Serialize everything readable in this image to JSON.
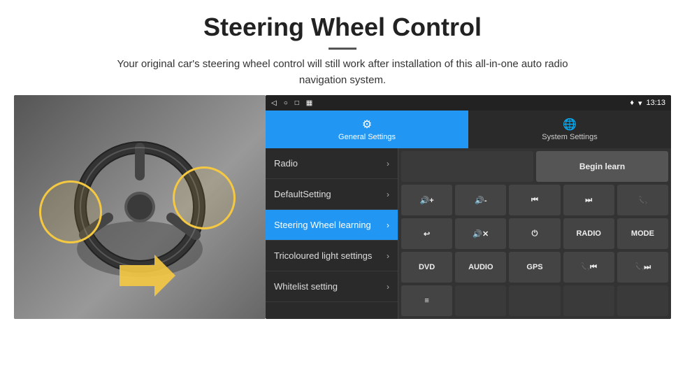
{
  "header": {
    "title": "Steering Wheel Control",
    "subtitle": "Your original car's steering wheel control will still work after installation of this all-in-one auto radio navigation system."
  },
  "status_bar": {
    "back_icon": "◁",
    "home_icon": "○",
    "recent_icon": "□",
    "screen_icon": "▦",
    "location_icon": "♦",
    "wifi_icon": "▾",
    "time": "13:13"
  },
  "tabs": [
    {
      "id": "general",
      "label": "General Settings",
      "icon": "⚙",
      "active": true
    },
    {
      "id": "system",
      "label": "System Settings",
      "icon": "🌐",
      "active": false
    }
  ],
  "menu": [
    {
      "id": "radio",
      "label": "Radio",
      "active": false
    },
    {
      "id": "default",
      "label": "DefaultSetting",
      "active": false
    },
    {
      "id": "steering",
      "label": "Steering Wheel learning",
      "active": true
    },
    {
      "id": "tricoloured",
      "label": "Tricoloured light settings",
      "active": false
    },
    {
      "id": "whitelist",
      "label": "Whitelist setting",
      "active": false
    }
  ],
  "controls": {
    "begin_learn": "Begin learn",
    "row1": [
      "🔊+",
      "🔊-",
      "⏮",
      "⏭",
      "📞"
    ],
    "row2": [
      "↩",
      "🔊✕",
      "⏻",
      "RADIO",
      "MODE"
    ],
    "row3": [
      "DVD",
      "AUDIO",
      "GPS",
      "📞⏮",
      "📞⏭"
    ],
    "row4": [
      "≡"
    ]
  }
}
